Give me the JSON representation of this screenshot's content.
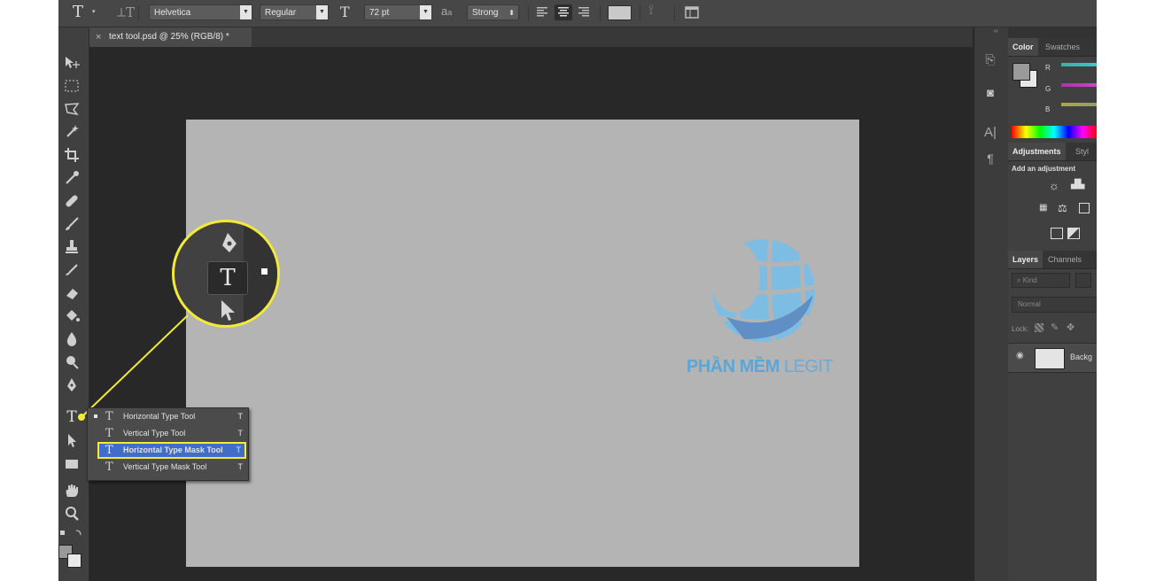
{
  "options_bar": {
    "font_family": "Helvetica",
    "font_style": "Regular",
    "font_size": "72 pt",
    "antialias": "Strong",
    "aa_icon_text": "a",
    "aa_icon_text2": "a"
  },
  "document_tab": {
    "title": "text tool.psd @ 25% (RGB/8) *",
    "close_glyph": "×"
  },
  "canvas": {
    "logo_text_1": "PHẦN MỀM",
    "logo_text_2": "LEGIT",
    "logo_color": "#6aaed6"
  },
  "flyout": {
    "items": [
      {
        "label": "Horizontal Type Tool",
        "shortcut": "T",
        "icon": "T"
      },
      {
        "label": "Vertical Type Tool",
        "shortcut": "T",
        "icon": "T"
      },
      {
        "label": "Horizontal Type Mask Tool",
        "shortcut": "T",
        "icon": "T"
      },
      {
        "label": "Vertical Type Mask Tool",
        "shortcut": "T",
        "icon": "T"
      }
    ]
  },
  "magnifier": {
    "type_glyph": "T"
  },
  "right_panel": {
    "color_tabs": [
      "Color",
      "Swatches"
    ],
    "channels": [
      "R",
      "G",
      "B"
    ],
    "adjustments_tabs": [
      "Adjustments",
      "Styl"
    ],
    "adjustments_hint": "Add an adjustment",
    "layers_tabs": [
      "Layers",
      "Channels"
    ],
    "kind_filter": "Kind",
    "blend_mode": "Normal",
    "lock_label": "Lock:",
    "layer_name": "Backg"
  },
  "toolbar": {
    "type_tool_glyph": "T"
  },
  "colors": {
    "accent_yellow": "#f5ea3a",
    "selection_blue": "#3f6dc9",
    "canvas_gray": "#b4b4b4"
  }
}
